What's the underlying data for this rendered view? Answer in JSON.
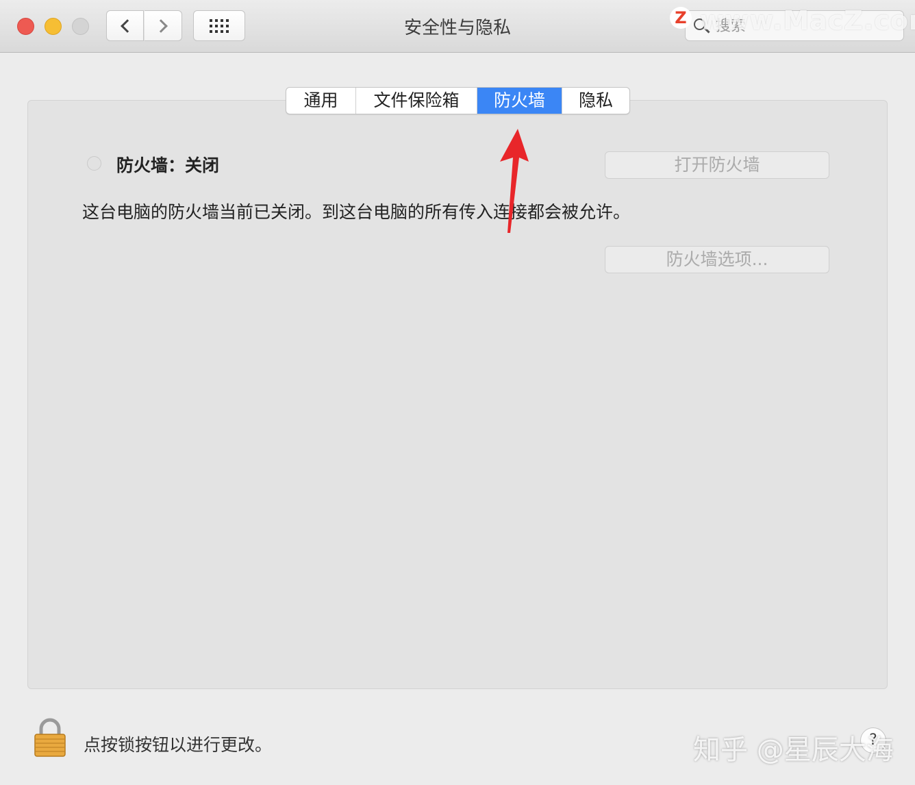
{
  "window": {
    "title": "安全性与隐私"
  },
  "search": {
    "placeholder": "搜索"
  },
  "watermark_top": "www.MacZ.com",
  "watermark_top_logo": "Z",
  "tabs": [
    {
      "label": "通用"
    },
    {
      "label": "文件保险箱"
    },
    {
      "label": "防火墙",
      "active": true
    },
    {
      "label": "隐私"
    }
  ],
  "firewall": {
    "status_label": "防火墙：关闭",
    "description": "这台电脑的防火墙当前已关闭。到这台电脑的所有传入连接都会被允许。",
    "turn_on_button": "打开防火墙",
    "options_button": "防火墙选项..."
  },
  "footer": {
    "lock_text": "点按锁按钮以进行更改。",
    "help_label": "?",
    "watermark": "知乎 @星辰大海"
  },
  "colors": {
    "accent": "#3b86f5",
    "annotation_arrow": "#e8262a"
  },
  "icons": [
    "search-icon",
    "chevron-left-icon",
    "chevron-right-icon",
    "grid-icon",
    "lock-icon",
    "help-icon",
    "annotation-arrow-icon"
  ]
}
